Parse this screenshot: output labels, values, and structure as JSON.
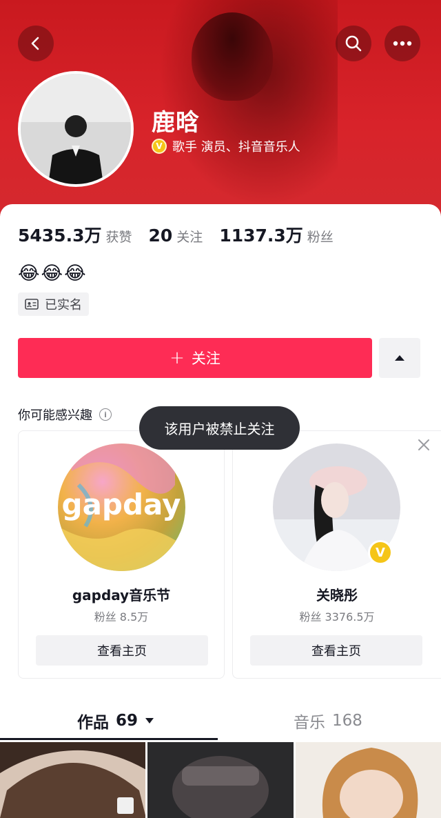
{
  "profile": {
    "name": "鹿晗",
    "verify_text": "歌手 演员、抖音音乐人",
    "verify_badge": "V",
    "stats": [
      {
        "value": "5435.3万",
        "label": "获赞"
      },
      {
        "value": "20",
        "label": "关注"
      },
      {
        "value": "1137.3万",
        "label": "粉丝"
      }
    ],
    "bio_emojis": "😂😂😂",
    "verified_tag": "已实名"
  },
  "actions": {
    "follow_plus": "+",
    "follow_label": "关注",
    "more_icon": "triangle-up-icon"
  },
  "suggestions": {
    "title": "你可能感兴趣",
    "info_icon": "i",
    "toast": "该用户被禁止关注",
    "items": [
      {
        "name": "gapday音乐节",
        "fans": "粉丝 8.5万",
        "button": "查看主页",
        "logo_text": "gapday"
      },
      {
        "name": "关晓彤",
        "fans": "粉丝 3376.5万",
        "button": "查看主页",
        "badge": "V"
      }
    ]
  },
  "tabs": [
    {
      "label": "作品",
      "count": "69",
      "active": true
    },
    {
      "label": "音乐",
      "count": "168",
      "active": false
    }
  ],
  "colors": {
    "header_red": "#d8232a",
    "follow_pink": "#fe2c55",
    "verify_gold": "#f5c518"
  }
}
